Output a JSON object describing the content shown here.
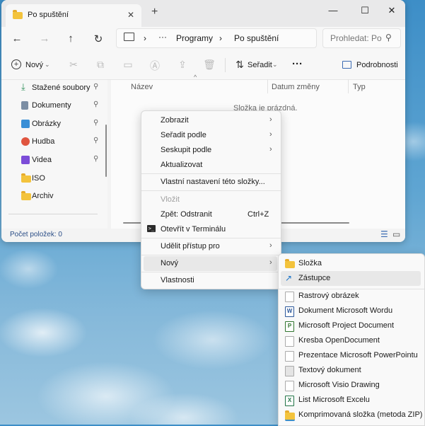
{
  "window": {
    "tab_title": "Po spuštění",
    "tab_close": "✕",
    "new_tab": "+",
    "min": "—",
    "max": "☐",
    "close": "✕"
  },
  "nav": {
    "back": "←",
    "forward": "→",
    "up": "↑",
    "refresh": "↻",
    "breadcrumb": [
      "Programy",
      "Po spuštění"
    ],
    "more": "···",
    "sep": "›",
    "search_placeholder": "Prohledat: Po spuštění"
  },
  "toolbar": {
    "new_label": "Nový",
    "sort_label": "Seřadit",
    "more": "···",
    "details_label": "Podrobnosti"
  },
  "sidebar": {
    "items": [
      {
        "label": "Stažené soubory",
        "pinned": true,
        "icon": "download-icon",
        "color": "#2f8f5a"
      },
      {
        "label": "Dokumenty",
        "pinned": true,
        "icon": "document-icon",
        "color": "#7c8ea4"
      },
      {
        "label": "Obrázky",
        "pinned": true,
        "icon": "pictures-icon",
        "color": "#3a8fd6"
      },
      {
        "label": "Hudba",
        "pinned": true,
        "icon": "music-icon",
        "color": "#e0553f"
      },
      {
        "label": "Videa",
        "pinned": true,
        "icon": "video-icon",
        "color": "#7c4dd8"
      },
      {
        "label": "ISO",
        "pinned": false,
        "icon": "folder-icon",
        "color": "#f3c33c"
      },
      {
        "label": "Archiv",
        "pinned": false,
        "icon": "folder-icon",
        "color": "#f3c33c"
      }
    ],
    "pin_glyph": "📌"
  },
  "content": {
    "columns": [
      "Název",
      "Datum změny",
      "Typ"
    ],
    "empty_text": "Složka je prázdná."
  },
  "status": {
    "count_text": "Počet položek: 0"
  },
  "context_menu": {
    "arrow": "›",
    "items": [
      {
        "label": "Zobrazit",
        "submenu": true
      },
      {
        "label": "Seřadit podle",
        "submenu": true
      },
      {
        "label": "Seskupit podle",
        "submenu": true
      },
      {
        "label": "Aktualizovat"
      },
      {
        "label": "Vlastní nastavení této složky..."
      },
      {
        "label": "Vložit",
        "disabled": true
      },
      {
        "label": "Zpět: Odstranit",
        "shortcut": "Ctrl+Z"
      },
      {
        "label": "Otevřít v Terminálu"
      },
      {
        "label": "Udělit přístup pro",
        "submenu": true
      },
      {
        "label": "Nový",
        "submenu": true
      },
      {
        "label": "Vlastnosti"
      }
    ]
  },
  "new_submenu": {
    "items": [
      {
        "label": "Složka",
        "icon": "folder-icon",
        "color": "#f3c33c"
      },
      {
        "label": "Zástupce",
        "icon": "shortcut-arrow-icon",
        "color": "#1a73c8"
      },
      {
        "label": "Rastrový obrázek",
        "icon": "blank-file-icon",
        "color": "#ffffff"
      },
      {
        "label": "Dokument Microsoft Wordu",
        "icon": "word-icon",
        "color": "#2b579a"
      },
      {
        "label": "Microsoft Project Document",
        "icon": "project-icon",
        "color": "#31752f"
      },
      {
        "label": "Kresba OpenDocument",
        "icon": "blank-file-icon",
        "color": "#ffffff"
      },
      {
        "label": "Prezentace Microsoft PowerPointu",
        "icon": "blank-file-icon",
        "color": "#ffffff"
      },
      {
        "label": "Textový dokument",
        "icon": "text-file-icon",
        "color": "#e4e4e4"
      },
      {
        "label": "Microsoft Visio Drawing",
        "icon": "blank-file-icon",
        "color": "#ffffff"
      },
      {
        "label": "List Microsoft Excelu",
        "icon": "excel-icon",
        "color": "#217346"
      },
      {
        "label": "Komprimovaná složka (metoda ZIP)",
        "icon": "zip-folder-icon",
        "color": "#f3c33c"
      }
    ]
  }
}
